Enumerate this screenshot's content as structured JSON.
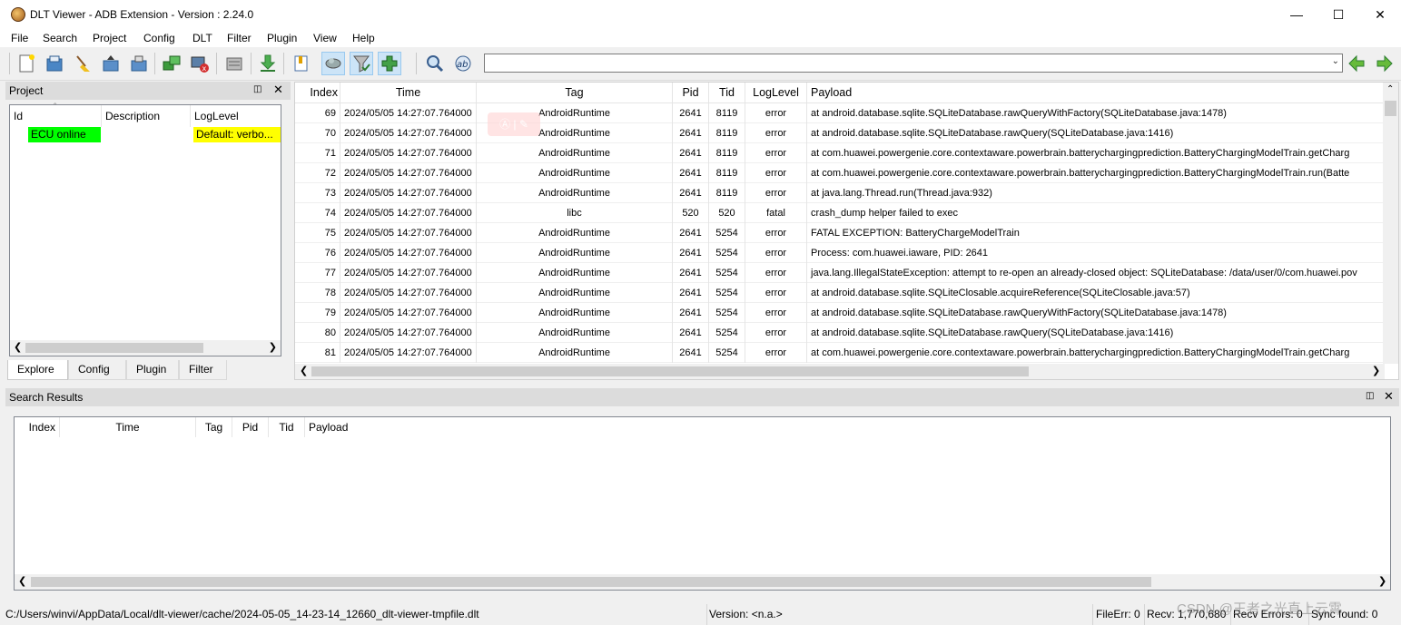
{
  "window": {
    "title": "DLT Viewer - ADB Extension - Version : 2.24.0",
    "minimize": "—",
    "maximize": "☐",
    "close": "✕"
  },
  "menu": [
    "File",
    "Search",
    "Project",
    "Config",
    "DLT",
    "Filter",
    "Plugin",
    "View",
    "Help"
  ],
  "toolbar_icons": [
    "new-file-icon",
    "open-file-icon",
    "clear-icon",
    "import-icon",
    "export-icon",
    "connect-icon",
    "disconnect-icon",
    "settings-icon",
    "download-icon",
    "bookmark-icon",
    "cloud-icon",
    "filter-icon",
    "plugin-icon",
    "search-icon",
    "regex-icon",
    "back-arrow-icon",
    "forward-arrow-icon"
  ],
  "project": {
    "title": "Project",
    "columns": [
      "Id",
      "Description",
      "LogLevel"
    ],
    "rows": [
      {
        "id": "ECU online",
        "description": "",
        "loglevel": "Default: verbo..."
      }
    ],
    "tabs": [
      "Explore",
      "Config",
      "Plugin",
      "Filter"
    ]
  },
  "log": {
    "columns": [
      "Index",
      "Time",
      "Tag",
      "Pid",
      "Tid",
      "LogLevel",
      "Payload"
    ],
    "rows": [
      {
        "index": "69",
        "time": "2024/05/05 14:27:07.764000",
        "tag": "AndroidRuntime",
        "pid": "2641",
        "tid": "8119",
        "level": "error",
        "payload": "at android.database.sqlite.SQLiteDatabase.rawQueryWithFactory(SQLiteDatabase.java:1478)"
      },
      {
        "index": "70",
        "time": "2024/05/05 14:27:07.764000",
        "tag": "AndroidRuntime",
        "pid": "2641",
        "tid": "8119",
        "level": "error",
        "payload": "at android.database.sqlite.SQLiteDatabase.rawQuery(SQLiteDatabase.java:1416)"
      },
      {
        "index": "71",
        "time": "2024/05/05 14:27:07.764000",
        "tag": "AndroidRuntime",
        "pid": "2641",
        "tid": "8119",
        "level": "error",
        "payload": "at com.huawei.powergenie.core.contextaware.powerbrain.batterychargingprediction.BatteryChargingModelTrain.getCharg"
      },
      {
        "index": "72",
        "time": "2024/05/05 14:27:07.764000",
        "tag": "AndroidRuntime",
        "pid": "2641",
        "tid": "8119",
        "level": "error",
        "payload": "at com.huawei.powergenie.core.contextaware.powerbrain.batterychargingprediction.BatteryChargingModelTrain.run(Batte"
      },
      {
        "index": "73",
        "time": "2024/05/05 14:27:07.764000",
        "tag": "AndroidRuntime",
        "pid": "2641",
        "tid": "8119",
        "level": "error",
        "payload": "at java.lang.Thread.run(Thread.java:932)"
      },
      {
        "index": "74",
        "time": "2024/05/05 14:27:07.764000",
        "tag": "libc",
        "pid": "520",
        "tid": "520",
        "level": "fatal",
        "payload": "crash_dump helper failed to exec"
      },
      {
        "index": "75",
        "time": "2024/05/05 14:27:07.764000",
        "tag": "AndroidRuntime",
        "pid": "2641",
        "tid": "5254",
        "level": "error",
        "payload": "FATAL EXCEPTION: BatteryChargeModelTrain"
      },
      {
        "index": "76",
        "time": "2024/05/05 14:27:07.764000",
        "tag": "AndroidRuntime",
        "pid": "2641",
        "tid": "5254",
        "level": "error",
        "payload": "Process: com.huawei.iaware, PID: 2641"
      },
      {
        "index": "77",
        "time": "2024/05/05 14:27:07.764000",
        "tag": "AndroidRuntime",
        "pid": "2641",
        "tid": "5254",
        "level": "error",
        "payload": "java.lang.IllegalStateException: attempt to re-open an already-closed object: SQLiteDatabase: /data/user/0/com.huawei.pov"
      },
      {
        "index": "78",
        "time": "2024/05/05 14:27:07.764000",
        "tag": "AndroidRuntime",
        "pid": "2641",
        "tid": "5254",
        "level": "error",
        "payload": "at android.database.sqlite.SQLiteClosable.acquireReference(SQLiteClosable.java:57)"
      },
      {
        "index": "79",
        "time": "2024/05/05 14:27:07.764000",
        "tag": "AndroidRuntime",
        "pid": "2641",
        "tid": "5254",
        "level": "error",
        "payload": "at android.database.sqlite.SQLiteDatabase.rawQueryWithFactory(SQLiteDatabase.java:1478)"
      },
      {
        "index": "80",
        "time": "2024/05/05 14:27:07.764000",
        "tag": "AndroidRuntime",
        "pid": "2641",
        "tid": "5254",
        "level": "error",
        "payload": "at android.database.sqlite.SQLiteDatabase.rawQuery(SQLiteDatabase.java:1416)"
      },
      {
        "index": "81",
        "time": "2024/05/05 14:27:07.764000",
        "tag": "AndroidRuntime",
        "pid": "2641",
        "tid": "5254",
        "level": "error",
        "payload": "at com.huawei.powergenie.core.contextaware.powerbrain.batterychargingprediction.BatteryChargingModelTrain.getCharg"
      }
    ]
  },
  "search": {
    "title": "Search Results",
    "columns": [
      "Index",
      "Time",
      "Tag",
      "Pid",
      "Tid",
      "Payload"
    ]
  },
  "status": {
    "file": "C:/Users/winvi/AppData/Local/dlt-viewer/cache/2024-05-05_14-23-14_12660_dlt-viewer-tmpfile.dlt",
    "version": "Version: <n.a.>",
    "file_err": "FileErr: 0",
    "recv": "Recv: 1,770,680",
    "recv_errors": "Recv Errors: 0",
    "sync_found": "Sync found: 0",
    "watermark": "CSDN @王者之光直上云霄"
  },
  "colors": {
    "ecu_online": "#00ff00",
    "default_level": "#ffff00",
    "active_tool": "#cce4f7"
  }
}
